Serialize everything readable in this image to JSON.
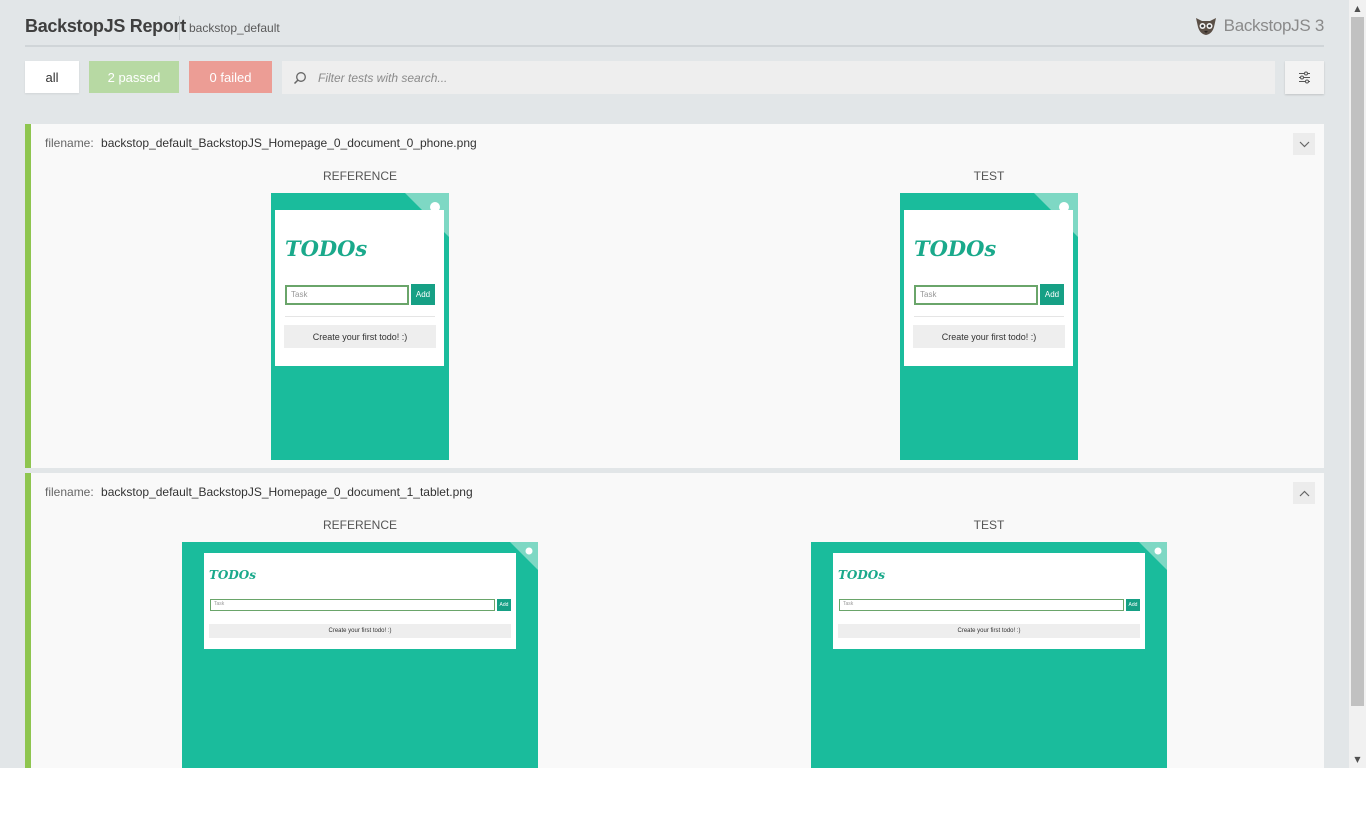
{
  "header": {
    "title": "BackstopJS Report",
    "subtitle": "backstop_default",
    "brand": "BackstopJS 3"
  },
  "toolbar": {
    "all_label": "all",
    "passed_label": "2 passed",
    "failed_label": "0 failed",
    "search_placeholder": "Filter tests with search..."
  },
  "tests": [
    {
      "filename_label": "filename:",
      "filename": "backstop_default_BackstopJS_Homepage_0_document_0_phone.png",
      "reference_label": "REFERENCE",
      "test_label": "TEST",
      "toggle": "collapsed",
      "app": {
        "title": "TODOs",
        "placeholder": "Task",
        "add_label": "Add",
        "empty_message": "Create your first todo! :)"
      }
    },
    {
      "filename_label": "filename:",
      "filename": "backstop_default_BackstopJS_Homepage_0_document_1_tablet.png",
      "reference_label": "REFERENCE",
      "test_label": "TEST",
      "toggle": "expanded",
      "app": {
        "title": "TODOs",
        "placeholder": "Task",
        "add_label": "Add",
        "empty_message": "Create your first todo! :)"
      }
    }
  ],
  "colors": {
    "pass_accent": "#8ec54f",
    "passed_bg": "#b7d9a3",
    "failed_bg": "#ec9d95",
    "screenshot_bg": "#1abc9c"
  }
}
